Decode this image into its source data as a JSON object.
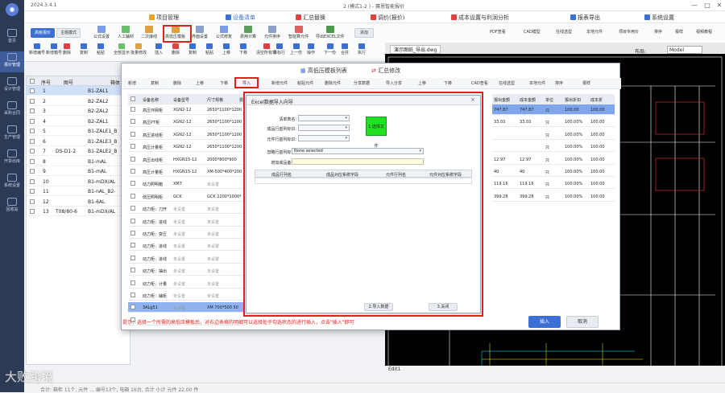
{
  "window": {
    "version": "2024.3.4.1",
    "title": "2 (模式1-2 ) - 赛恩智能报价",
    "controls": [
      "—",
      "□",
      "✕"
    ]
  },
  "sidebar": {
    "items": [
      {
        "label": "首页",
        "active": false
      },
      {
        "label": "报价管理",
        "active": true
      },
      {
        "label": "设计管理",
        "active": false
      },
      {
        "label": "采购合同",
        "active": false
      },
      {
        "label": "生产管理",
        "active": false
      },
      {
        "label": "开票出库",
        "active": false
      },
      {
        "label": "系统设置",
        "active": false
      },
      {
        "label": "回收站",
        "active": false
      }
    ]
  },
  "menubar": {
    "items": [
      {
        "label": "项目管理",
        "color": "#f0a020",
        "active": false
      },
      {
        "label": "设备清单",
        "color": "#3b6fd4",
        "active": true
      },
      {
        "label": "汇总替换",
        "color": "#e04040",
        "active": false
      },
      {
        "label": "调价(报价)",
        "color": "#e04040",
        "active": false
      },
      {
        "label": "成本设置与利润分析",
        "color": "#e04040",
        "active": false
      },
      {
        "label": "报表导出",
        "color": "#3b6fd4",
        "active": false
      },
      {
        "label": "系统设置",
        "color": "#3b6fd4",
        "active": false
      }
    ]
  },
  "ribbon": {
    "mode_buttons": [
      "高级报价",
      "主题模式"
    ],
    "top_tools": [
      "公式设置",
      "人工辅材",
      "二次接线",
      "高低压模板",
      "界面设置",
      "公式修复",
      "费用计算",
      "元件排序",
      "智能算元件",
      "导出EXCEL文件"
    ],
    "add_button": "添加",
    "bottom_tools": [
      "新增编号",
      "新增箱号",
      "删除",
      "复制",
      "粘贴",
      "全部显示",
      "批量修改",
      "插入",
      "删除",
      "复制",
      "粘贴",
      "上移",
      "下移",
      "清空所有项",
      "单标行",
      "上一份",
      "操作",
      "下一份",
      "合并",
      "执行"
    ],
    "right_tools": [
      "PDF查看",
      "CAD模型",
      "在线选型",
      "本地元件",
      "项目专用价",
      "排序",
      "报样",
      "视频教程"
    ]
  },
  "cad": {
    "tab": "演示图纸_导出.dwg",
    "layout_label": "布局:",
    "layout_value": "Model",
    "command": "Edit1"
  },
  "bg_table": {
    "headers": [
      "",
      "序号",
      "图号",
      "箱体"
    ],
    "rows": [
      {
        "no": "1",
        "code": "",
        "name": "B1-ZAL1"
      },
      {
        "no": "2",
        "code": "",
        "name": "B2-ZAL2"
      },
      {
        "no": "3",
        "code": "",
        "name": "B2-ZAL2"
      },
      {
        "no": "4",
        "code": "",
        "name": "B2-ZAL1"
      },
      {
        "no": "5",
        "code": "",
        "name": "B1-ZALE1_B"
      },
      {
        "no": "6",
        "code": "",
        "name": "B1-ZALE3_B"
      },
      {
        "no": "7",
        "code": "DS-D1-2",
        "name": "B1-ZALE2_B"
      },
      {
        "no": "8",
        "code": "",
        "name": "B1-mAL"
      },
      {
        "no": "9",
        "code": "",
        "name": "B1-mAL"
      },
      {
        "no": "10",
        "code": "",
        "name": "B1-mDX/AL"
      },
      {
        "no": "11",
        "code": "",
        "name": "B1-nAL_B2-"
      },
      {
        "no": "12",
        "code": "",
        "name": "B1-6AL"
      },
      {
        "no": "13",
        "code": "T08/80-6",
        "name": "B1-mDX/AL"
      }
    ]
  },
  "dialog": {
    "tabs": [
      "高低压模板列表",
      "汇总修改"
    ],
    "toolbar_left": [
      "新增",
      "复制",
      "删除",
      "上移",
      "下移",
      "导入"
    ],
    "toolbar_mid": [
      "新增元件",
      "粘贴元件",
      "删除元件",
      "分享数据",
      "导入分享",
      "上移",
      "下移",
      "CAD查看",
      "在线选型",
      "本地元件",
      "排序",
      "报样"
    ],
    "left_headers": [
      "",
      "设备名称",
      "设备型号",
      "尺寸规格",
      "费"
    ],
    "left_rows": [
      {
        "name": "高压环网柜",
        "model": "XGN2-12",
        "size": "2650*1100*1200",
        "sel": false
      },
      {
        "name": "高压PT柜",
        "model": "XGN2-12",
        "size": "2650*1100*1200",
        "sel": false
      },
      {
        "name": "高压进线柜",
        "model": "XGN2-12",
        "size": "2650*1100*1200",
        "sel": false
      },
      {
        "name": "高压计量柜",
        "model": "XGN2-12",
        "size": "2650*1100*1200",
        "sel": false
      },
      {
        "name": "高压出线柜",
        "model": "HXGN15-12",
        "size": "2000*800*900",
        "sel": false
      },
      {
        "name": "高压计量柜",
        "model": "HXGN15-12",
        "size": "XM-500*400*200",
        "sel": false
      },
      {
        "name": "动力照明箱",
        "model": "XM7",
        "size": "未设置",
        "sel": false
      },
      {
        "name": "低压照明柜",
        "model": "GCK",
        "size": "GCK 2200*1000*",
        "sel": false
      },
      {
        "name": "动力柜：刀开",
        "model": "未设置",
        "size": "未设置",
        "sel": false
      },
      {
        "name": "动力柜：进线",
        "model": "未设置",
        "size": "未设置",
        "sel": false
      },
      {
        "name": "动力柜：变压",
        "model": "未设置",
        "size": "未设置",
        "sel": false
      },
      {
        "name": "动力柜：进线",
        "model": "未设置",
        "size": "未设置",
        "sel": false
      },
      {
        "name": "动力柜：进线",
        "model": "未设置",
        "size": "未设置",
        "sel": false
      },
      {
        "name": "动力柜：抽出",
        "model": "未设置",
        "size": "未设置",
        "sel": false
      },
      {
        "name": "动力柜：计量",
        "model": "未设置",
        "size": "未设置",
        "sel": false
      },
      {
        "name": "动力柜：辅柜",
        "model": "未设置",
        "size": "未设置",
        "sel": false
      },
      {
        "name": "3ALg51",
        "model": "未设置",
        "size": "XM 700*500 50",
        "sel": true
      },
      {
        "name": "",
        "model": "",
        "size": "",
        "sel": false
      }
    ],
    "right_headers": [
      "报出金额",
      "成本金额",
      "单位",
      "报出折扣",
      "成本折"
    ],
    "right_rows": [
      [
        "747.87",
        "747.87",
        "只",
        "100.00",
        "100.00"
      ],
      [
        "33.03",
        "33.03",
        "只",
        "100.00%",
        "100.00"
      ],
      [
        "",
        "",
        "只",
        "100.00%",
        "100.00"
      ],
      [
        "",
        "",
        "只",
        "100.00%",
        "100.00"
      ],
      [
        "12.97",
        "12.97",
        "只",
        "100.00%",
        "100.00"
      ],
      [
        "40",
        "40",
        "只",
        "100.00%",
        "100.00"
      ],
      [
        "119.16",
        "119.16",
        "只",
        "100.00%",
        "100.00"
      ],
      [
        "399.28",
        "399.28",
        "只",
        "100.00%",
        "100.00"
      ]
    ],
    "tip": "提示：选择一个所需的高低压模板后，对右边表格的明细可以选择处于勾选状态的进行插入，点击\"插入\"即可",
    "insert_button": "插入",
    "cancel_button": "取消"
  },
  "excel_dialog": {
    "title": "Excel数据导入向导",
    "fields": [
      {
        "label": "清单表名:",
        "value": ""
      },
      {
        "label": "成品行首列标识:",
        "value": ""
      },
      {
        "label": "元件行首列标识:",
        "value": ""
      },
      {
        "label": "忽略行首列标识:",
        "value": "None selected"
      },
      {
        "label": "增加成品备注:",
        "value": ""
      }
    ],
    "select_file_button": "1.选择文件",
    "grid_headers": [
      "成品行列名",
      "成品对应系统字段",
      "元件行列名",
      "元件对应系统字段"
    ],
    "import_button": "2.导入数据",
    "close_button": "3.关闭"
  },
  "status": {
    "text": "合计: 箱柜 11个, 元件 ... 编号13个, 电箱 16台, 合计 小计 元件 22.00 件"
  },
  "watermark": "大败跨境"
}
